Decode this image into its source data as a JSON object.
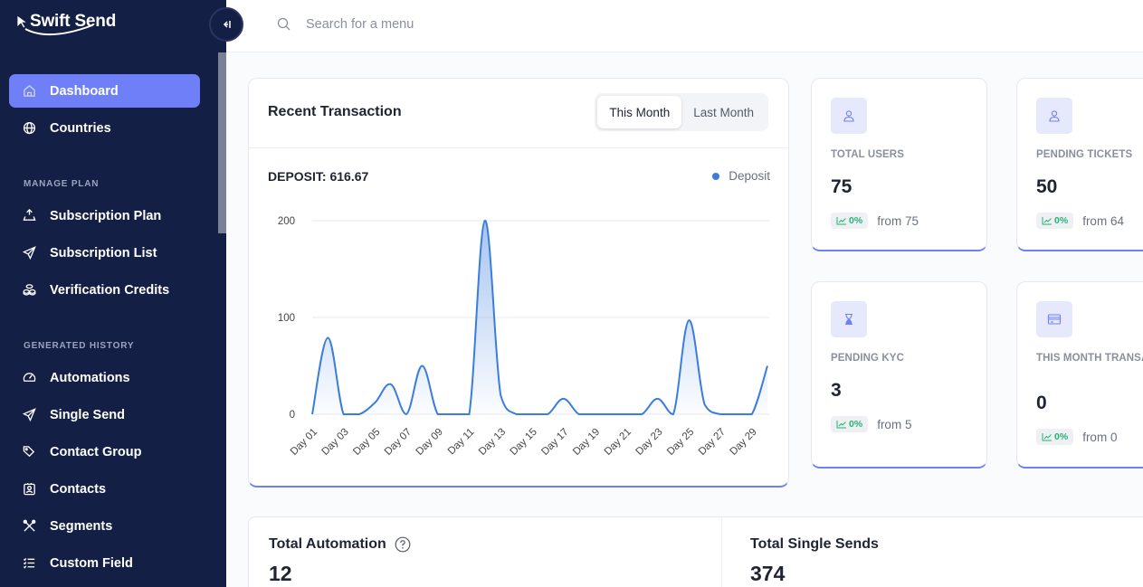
{
  "app": {
    "name": "Swift Send"
  },
  "sidebar": {
    "items": [
      {
        "label": "Dashboard",
        "icon": "home-icon",
        "active": true
      },
      {
        "label": "Countries",
        "icon": "globe-icon"
      }
    ],
    "sections": [
      {
        "title": "MANAGE PLAN",
        "items": [
          {
            "label": "Subscription Plan",
            "icon": "recycle-icon"
          },
          {
            "label": "Subscription List",
            "icon": "send-icon"
          },
          {
            "label": "Verification Credits",
            "icon": "coins-icon"
          }
        ]
      },
      {
        "title": "GENERATED HISTORY",
        "items": [
          {
            "label": "Automations",
            "icon": "gauge-icon"
          },
          {
            "label": "Single Send",
            "icon": "send-icon"
          },
          {
            "label": "Contact Group",
            "icon": "tags-icon"
          },
          {
            "label": "Contacts",
            "icon": "contact-card-icon"
          },
          {
            "label": "Segments",
            "icon": "tools-icon"
          },
          {
            "label": "Custom Field",
            "icon": "list-icon"
          }
        ]
      }
    ]
  },
  "search": {
    "placeholder": "Search for a menu"
  },
  "transactions": {
    "title": "Recent Transaction",
    "tabs": [
      {
        "label": "This Month",
        "active": true
      },
      {
        "label": "Last Month",
        "active": false
      }
    ],
    "deposit_label": "DEPOSIT: 616.67",
    "legend": "Deposit"
  },
  "chart_data": {
    "type": "area",
    "title": "",
    "xlabel": "",
    "ylabel": "",
    "ylim": [
      0,
      200
    ],
    "yticks": [
      0,
      100,
      200
    ],
    "grid": true,
    "legend_position": "top-right",
    "x": [
      "Day 01",
      "Day 02",
      "Day 03",
      "Day 04",
      "Day 05",
      "Day 06",
      "Day 07",
      "Day 08",
      "Day 09",
      "Day 10",
      "Day 11",
      "Day 12",
      "Day 13",
      "Day 14",
      "Day 15",
      "Day 16",
      "Day 17",
      "Day 18",
      "Day 19",
      "Day 20",
      "Day 21",
      "Day 22",
      "Day 23",
      "Day 24",
      "Day 25",
      "Day 26",
      "Day 27",
      "Day 28",
      "Day 29",
      "Day 30"
    ],
    "x_tick_labels": [
      "Day 01",
      "Day 03",
      "Day 05",
      "Day 07",
      "Day 09",
      "Day 11",
      "Day 13",
      "Day 15",
      "Day 17",
      "Day 19",
      "Day 21",
      "Day 23",
      "Day 25",
      "Day 27",
      "Day 29"
    ],
    "series": [
      {
        "name": "Deposit",
        "color": "#3b7ddd",
        "values": [
          0,
          79,
          0,
          0,
          12,
          31,
          0,
          50,
          0,
          0,
          0,
          200,
          20,
          0,
          0,
          0,
          16,
          0,
          0,
          0,
          0,
          0,
          16,
          0,
          97,
          10,
          0,
          0,
          0,
          50
        ]
      }
    ]
  },
  "stats": [
    {
      "label": "TOTAL USERS",
      "value": "75",
      "pct": "0%",
      "from": "from 75",
      "icon": "user-icon"
    },
    {
      "label": "PENDING TICKETS",
      "value": "50",
      "pct": "0%",
      "from": "from 64",
      "icon": "user-icon"
    },
    {
      "label": "PENDING KYC",
      "value": "3",
      "pct": "0%",
      "from": "from 5",
      "icon": "hourglass-icon"
    },
    {
      "label": "THIS MONTH TRANSACTIONS",
      "value": "0",
      "pct": "0%",
      "from": "from 0",
      "icon": "credit-card-icon"
    }
  ],
  "bottom": {
    "automation": {
      "title": "Total Automation",
      "value": "12"
    },
    "single_sends": {
      "title": "Total Single Sends",
      "value": "374"
    }
  },
  "colors": {
    "sidebar": "#141f45",
    "accent": "#6f7ff7",
    "line": "#3b7ddd",
    "positive": "#22b573"
  }
}
